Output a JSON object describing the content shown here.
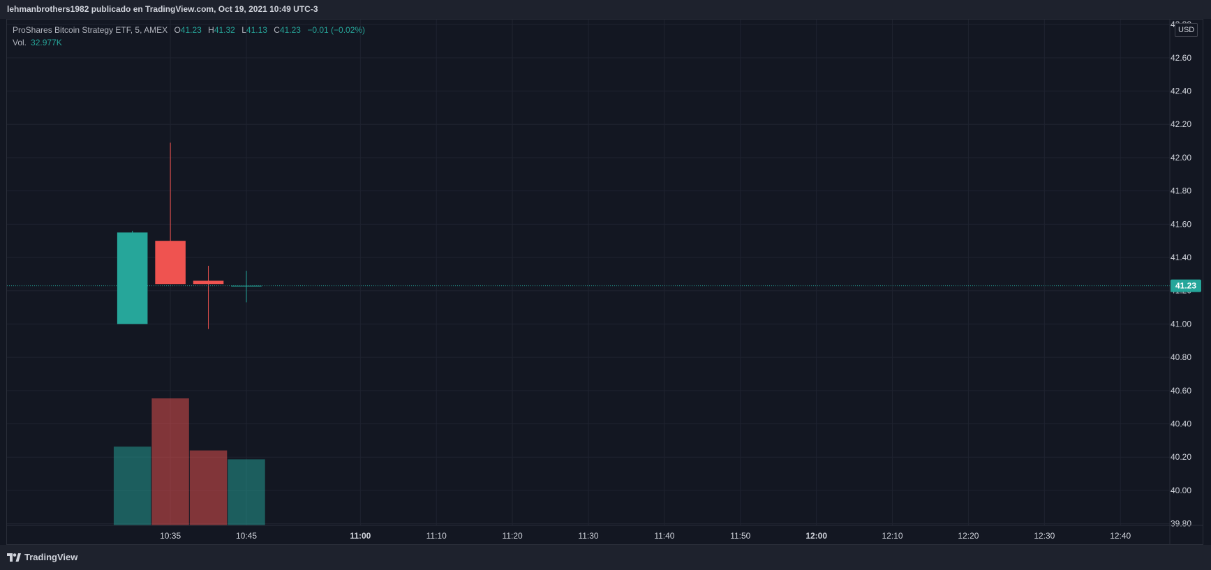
{
  "header": {
    "attribution": "lehmanbrothers1982 publicado en TradingView.com, Oct 19, 2021 10:49 UTC-3"
  },
  "legend": {
    "symbol": "ProShares Bitcoin Strategy ETF, 5, AMEX",
    "open_label": "O",
    "open": "41.23",
    "high_label": "H",
    "high": "41.32",
    "low_label": "L",
    "low": "41.13",
    "close_label": "C",
    "close": "41.23",
    "change": "−0.01 (−0.02%)",
    "volume_label": "Vol.",
    "volume": "32.977K"
  },
  "currency": "USD",
  "footer": {
    "brand": "TradingView"
  },
  "colors": {
    "background": "#131722",
    "up": "#26a69a",
    "down": "#ef5350",
    "grid": "#1f2330",
    "axis_text": "#d1d4dc"
  },
  "chart_data": {
    "type": "candlestick",
    "interval": "5",
    "candles": [
      {
        "time": "10:30",
        "open": 41.0,
        "high": 41.56,
        "low": 41.0,
        "close": 41.55,
        "direction": "up"
      },
      {
        "time": "10:35",
        "open": 41.5,
        "high": 42.09,
        "low": 41.24,
        "close": 41.24,
        "direction": "down"
      },
      {
        "time": "10:40",
        "open": 41.26,
        "high": 41.35,
        "low": 40.97,
        "close": 41.24,
        "direction": "down"
      },
      {
        "time": "10:45",
        "open": 41.23,
        "high": 41.32,
        "low": 41.13,
        "close": 41.23,
        "direction": "up"
      }
    ],
    "volume": {
      "values_relative": [
        0.62,
        1.0,
        0.59,
        0.52
      ],
      "last": "32.977K"
    },
    "y_axis": {
      "ticks": [
        "42.80",
        "42.60",
        "42.40",
        "42.20",
        "42.00",
        "41.80",
        "41.60",
        "41.40",
        "41.20",
        "41.00",
        "40.80",
        "40.60",
        "40.40",
        "40.20",
        "40.00",
        "39.80"
      ],
      "ylim": [
        39.79,
        42.83
      ],
      "last_price": "41.23",
      "last_price_value": 41.23
    },
    "x_axis": {
      "ticks": [
        "10:35",
        "10:45",
        "11:00",
        "11:10",
        "11:20",
        "11:30",
        "11:40",
        "11:50",
        "12:00",
        "12:10",
        "12:20",
        "12:30",
        "12:40"
      ],
      "bold_ticks": [
        "11:00",
        "12:00"
      ],
      "xlim_minutes": [
        613.5,
        766.5
      ]
    },
    "grid": true
  }
}
